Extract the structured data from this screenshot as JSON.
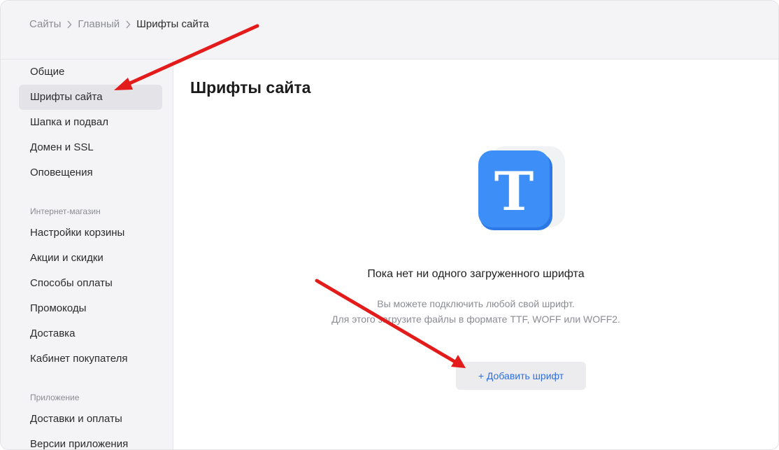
{
  "breadcrumb": [
    "Сайты",
    "Главный",
    "Шрифты сайта"
  ],
  "sidebar": {
    "group1": [
      "Общие",
      "Шрифты сайта",
      "Шапка и подвал",
      "Домен и SSL",
      "Оповещения"
    ],
    "section2_title": "Интернет-магазин",
    "group2": [
      "Настройки корзины",
      "Акции и скидки",
      "Способы оплаты",
      "Промокоды",
      "Доставка",
      "Кабинет покупателя"
    ],
    "section3_title": "Приложение",
    "group3": [
      "Доставки и оплаты",
      "Версии приложения"
    ],
    "active_item": "Шрифты сайта"
  },
  "main": {
    "title": "Шрифты сайта",
    "icon_glyph": "T",
    "empty_title": "Пока нет ни одного загруженного шрифта",
    "empty_desc_line1": "Вы можете подключить любой свой шрифт.",
    "empty_desc_line2": "Для этого загрузите файлы в формате TTF, WOFF или WOFF2.",
    "add_button": "+ Добавить шрифт"
  },
  "colors": {
    "accent_blue": "#3d8ff7",
    "link_blue": "#2f6fdb",
    "annotation_red": "#e31b1b"
  }
}
